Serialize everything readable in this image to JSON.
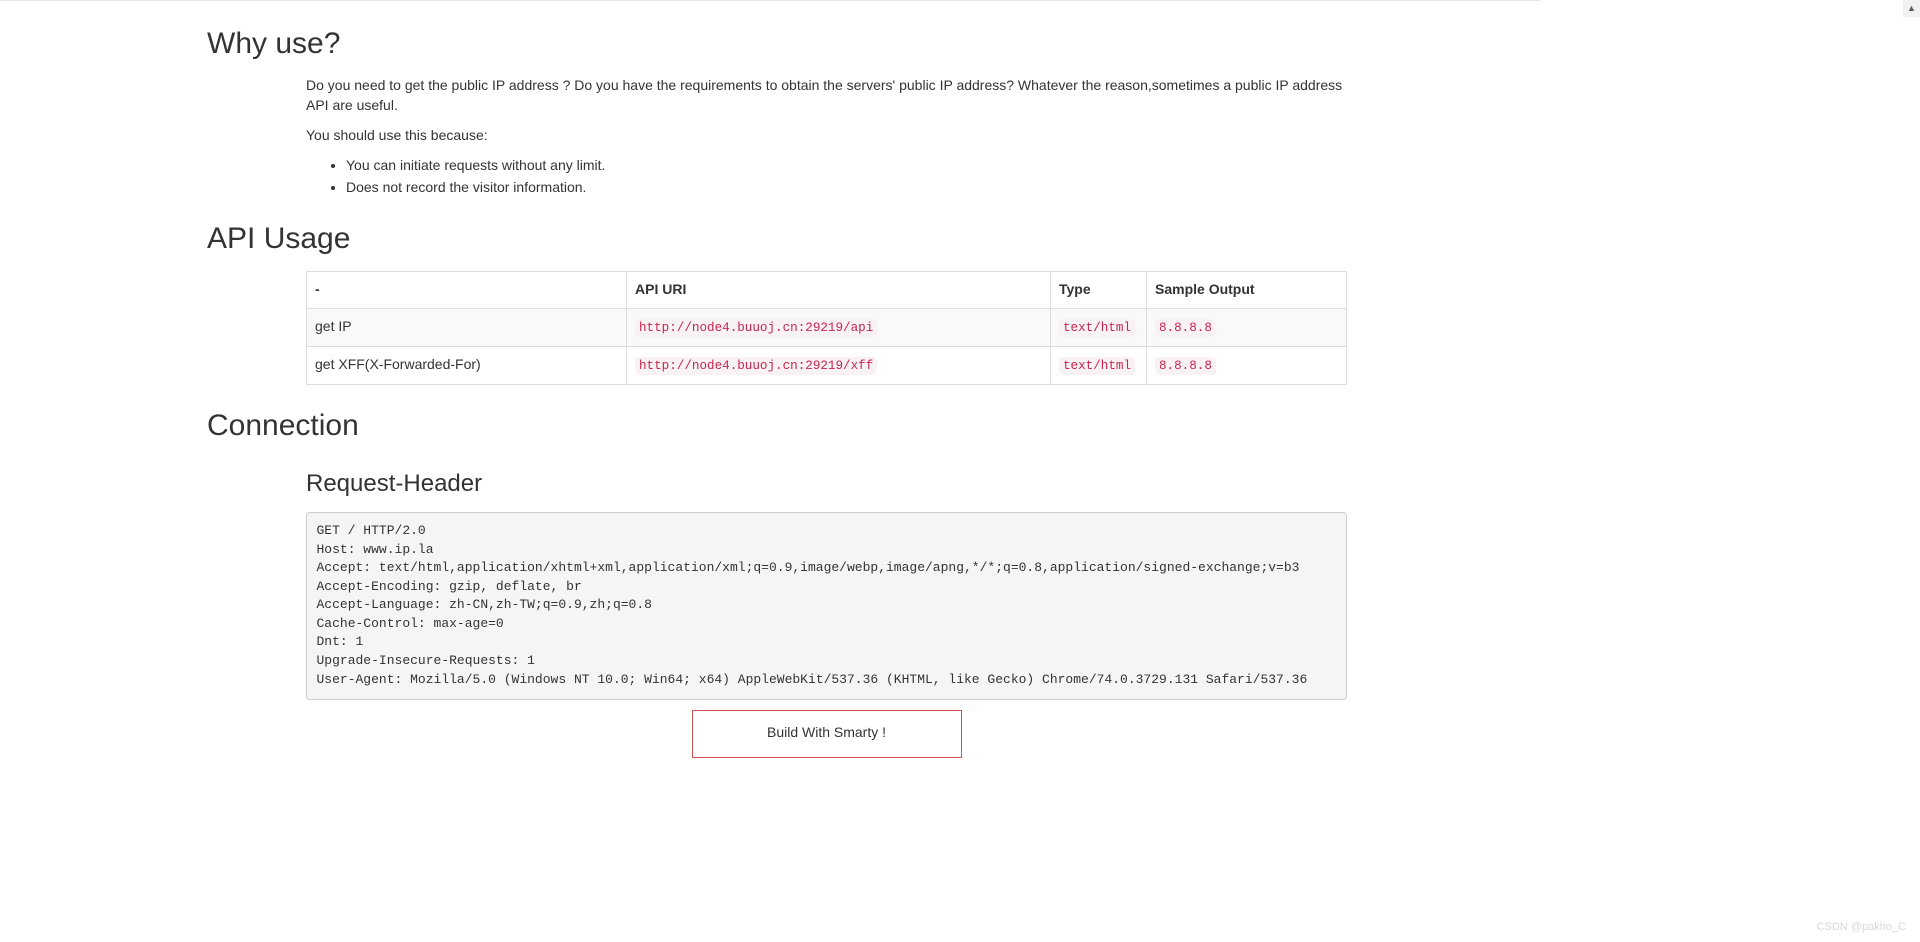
{
  "sections": {
    "why_use": {
      "heading": "Why use?",
      "intro": "Do you need to get the public IP address ? Do you have the requirements to obtain the servers' public IP address? Whatever the reason,sometimes a public IP address API are useful.",
      "should_use": "You should use this because:",
      "bullets": {
        "b0": "You can initiate requests without any limit.",
        "b1": "Does not record the visitor information."
      }
    },
    "api_usage": {
      "heading": "API Usage",
      "headers": {
        "c0": "-",
        "c1": "API URI",
        "c2": "Type",
        "c3": "Sample Output"
      },
      "rows": {
        "r0": {
          "name": "get IP",
          "uri": "http://node4.buuoj.cn:29219/api",
          "type": "text/html",
          "sample": "8.8.8.8"
        },
        "r1": {
          "name": "get XFF(X-Forwarded-For)",
          "uri": "http://node4.buuoj.cn:29219/xff",
          "type": "text/html",
          "sample": "8.8.8.8"
        }
      }
    },
    "connection": {
      "heading": "Connection",
      "subheading": "Request-Header",
      "request_header_raw": "GET / HTTP/2.0\nHost: www.ip.la\nAccept: text/html,application/xhtml+xml,application/xml;q=0.9,image/webp,image/apng,*/*;q=0.8,application/signed-exchange;v=b3\nAccept-Encoding: gzip, deflate, br\nAccept-Language: zh-CN,zh-TW;q=0.9,zh;q=0.8\nCache-Control: max-age=0\nDnt: 1\nUpgrade-Insecure-Requests: 1\nUser-Agent: Mozilla/5.0 (Windows NT 10.0; Win64; x64) AppleWebKit/537.36 (KHTML, like Gecko) Chrome/74.0.3729.131 Safari/537.36"
    }
  },
  "footer": {
    "text": "Build With Smarty !"
  },
  "watermark": "CSDN @pakho_C"
}
